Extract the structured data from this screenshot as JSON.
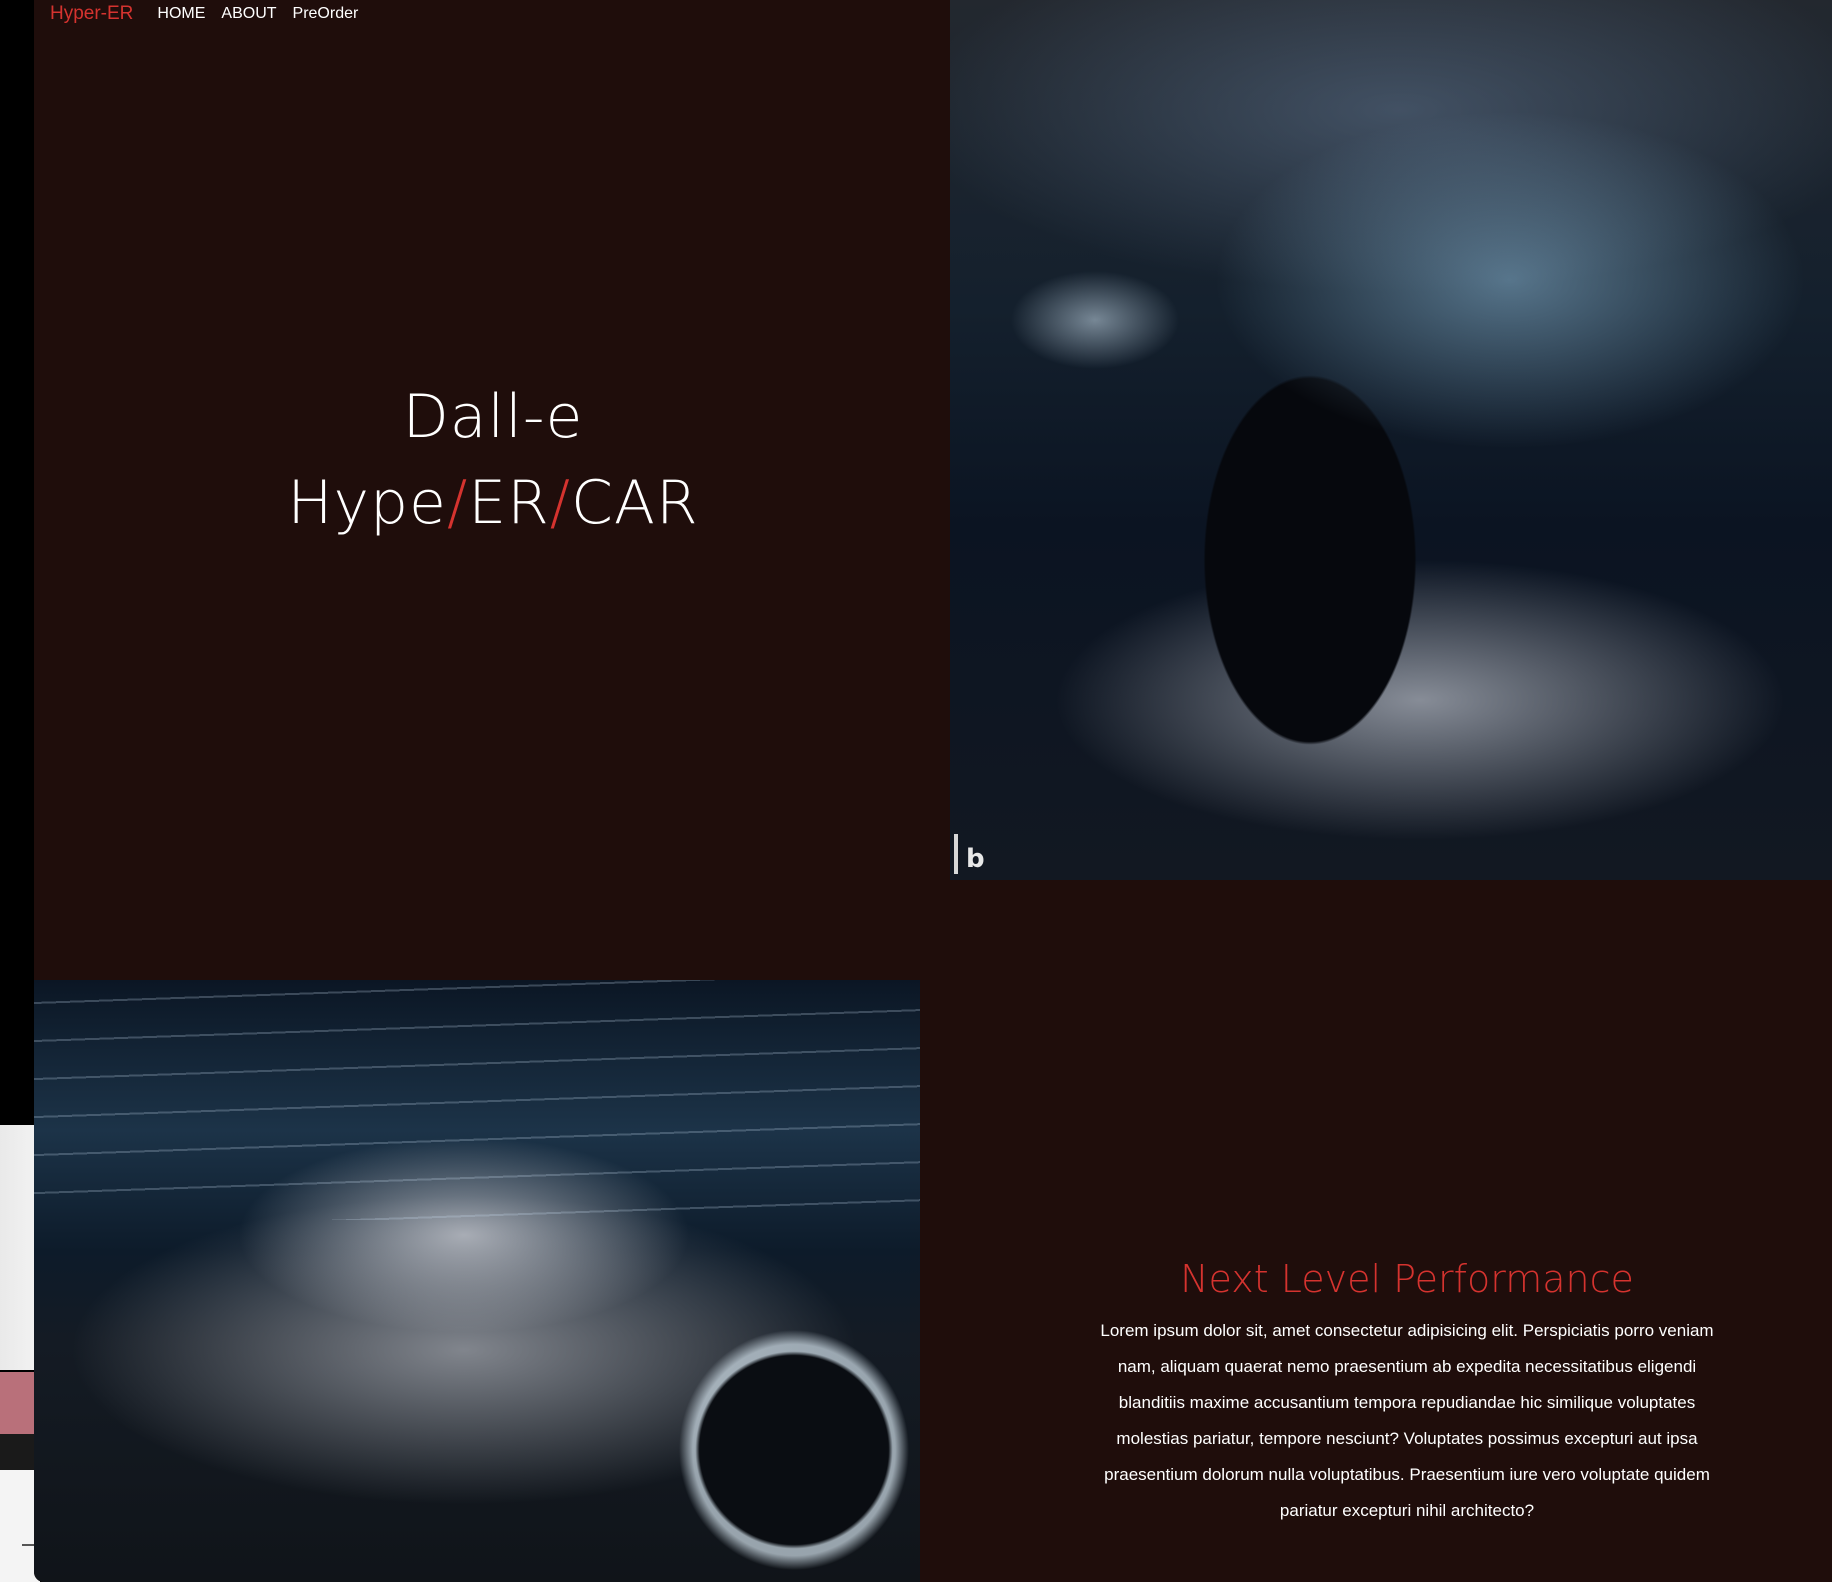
{
  "nav": {
    "brand": "Hyper-ER",
    "links": [
      "HOME",
      "ABOUT",
      "PreOrder"
    ]
  },
  "hero": {
    "line1": "Dall-e",
    "line2": {
      "part1": "Hype",
      "slash1": "/",
      "part2": "ER",
      "slash2": "/",
      "part3": "CAR"
    }
  },
  "section": {
    "heading": "Next Level Performance",
    "body": "Lorem ipsum dolor sit, amet consectetur adipisicing elit. Perspiciatis porro veniam nam, aliquam quaerat nemo praesentium ab expedita necessitatibus eligendi blanditiis maxime accusantium tempora repudiandae hic similique voluptates molestias pariatur, tempore nesciunt? Voluptates possimus excepturi aut ipsa praesentium dolorum nulla voluptatibus. Praesentium iure vero voluptate quidem pariatur excepturi nihil architecto?"
  },
  "colors": {
    "background": "#1f0d0b",
    "accent": "#d5332f",
    "text": "#ffffff"
  },
  "icons": {
    "watermark": "bing-icon"
  }
}
